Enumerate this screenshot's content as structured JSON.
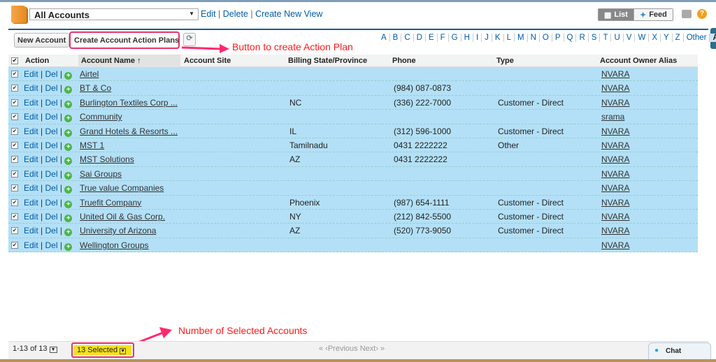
{
  "view": {
    "selected": "All Accounts",
    "links": [
      "Edit",
      "Delete",
      "Create New View"
    ]
  },
  "toggle": {
    "list": "List",
    "feed": "Feed"
  },
  "toolbar": {
    "new_account": "New Account",
    "create_plans": "Create Account Action Plans"
  },
  "alphabet": [
    "A",
    "B",
    "C",
    "D",
    "E",
    "F",
    "G",
    "H",
    "I",
    "J",
    "K",
    "L",
    "M",
    "N",
    "O",
    "P",
    "Q",
    "R",
    "S",
    "T",
    "U",
    "V",
    "W",
    "X",
    "Y",
    "Z",
    "Other",
    "All"
  ],
  "alphabet_selected": "All",
  "annotations": {
    "button": "Button to create Action Plan",
    "selected": "Number of Selected Accounts"
  },
  "columns": [
    "Action",
    "Account Name ↑",
    "Account Site",
    "Billing State/Province",
    "Phone",
    "Type",
    "Account Owner Alias"
  ],
  "action_links": {
    "edit": "Edit",
    "del": "Del"
  },
  "rows": [
    {
      "name": "Airtel",
      "site": "",
      "state": "",
      "phone": "",
      "type": "",
      "owner": "NVARA"
    },
    {
      "name": "BT & Co",
      "site": "",
      "state": "",
      "phone": "(984) 087-0873",
      "type": "",
      "owner": "NVARA"
    },
    {
      "name": "Burlington Textiles Corp ...",
      "site": "",
      "state": "NC",
      "phone": "(336) 222-7000",
      "type": "Customer - Direct",
      "owner": "NVARA"
    },
    {
      "name": "Community",
      "site": "",
      "state": "",
      "phone": "",
      "type": "",
      "owner": "srama"
    },
    {
      "name": "Grand Hotels & Resorts ...",
      "site": "",
      "state": "IL",
      "phone": "(312) 596-1000",
      "type": "Customer - Direct",
      "owner": "NVARA"
    },
    {
      "name": "MST 1",
      "site": "",
      "state": "Tamilnadu",
      "phone": "0431 2222222",
      "type": "Other",
      "owner": "NVARA"
    },
    {
      "name": "MST Solutions",
      "site": "",
      "state": "AZ",
      "phone": "0431 2222222",
      "type": "",
      "owner": "NVARA"
    },
    {
      "name": "Sai Groups",
      "site": "",
      "state": "",
      "phone": "",
      "type": "",
      "owner": "NVARA"
    },
    {
      "name": "True value Companies",
      "site": "",
      "state": "",
      "phone": "",
      "type": "",
      "owner": "NVARA"
    },
    {
      "name": "Truefit Company",
      "site": "",
      "state": "Phoenix",
      "phone": "(987) 654-1111",
      "type": "Customer - Direct",
      "owner": "NVARA"
    },
    {
      "name": "United Oil & Gas Corp.",
      "site": "",
      "state": "NY",
      "phone": "(212) 842-5500",
      "type": "Customer - Direct",
      "owner": "NVARA"
    },
    {
      "name": "University of Arizona",
      "site": "",
      "state": "AZ",
      "phone": "(520) 773-9050",
      "type": "Customer - Direct",
      "owner": "NVARA"
    },
    {
      "name": "Wellington Groups",
      "site": "",
      "state": "",
      "phone": "",
      "type": "",
      "owner": "NVARA"
    }
  ],
  "footer": {
    "range": "1-13 of 13",
    "selected": "13 Selected",
    "previous": "Previous",
    "next": "Next"
  },
  "chat": "Chat",
  "colors": {
    "row_selected": "#b3e0f7",
    "link": "#015ba7",
    "highlight": "#e8336a",
    "selected_badge": "#f7e11c"
  }
}
